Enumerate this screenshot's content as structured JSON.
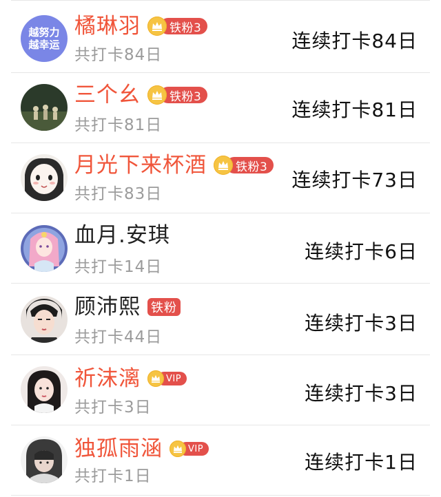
{
  "list": {
    "rows": [
      {
        "name": "橘琳羽",
        "name_color": "fan",
        "badge_type": "fan",
        "badge_label": "铁粉3",
        "total": "共打卡84日",
        "streak": "连续打卡84日"
      },
      {
        "name": "三个幺",
        "name_color": "fan",
        "badge_type": "fan",
        "badge_label": "铁粉3",
        "total": "共打卡81日",
        "streak": "连续打卡81日"
      },
      {
        "name": "月光下来杯酒",
        "name_color": "fan",
        "badge_type": "fan",
        "badge_label": "铁粉3",
        "total": "共打卡83日",
        "streak": "连续打卡73日"
      },
      {
        "name": "血月.安琪",
        "name_color": "plain",
        "badge_type": "none",
        "badge_label": "",
        "total": "共打卡14日",
        "streak": "连续打卡6日"
      },
      {
        "name": "顾沛熙",
        "name_color": "plain",
        "badge_type": "tag",
        "badge_label": "铁粉",
        "total": "共打卡44日",
        "streak": "连续打卡3日"
      },
      {
        "name": "祈沫漓",
        "name_color": "fan",
        "badge_type": "vip",
        "badge_label": "VIP",
        "total": "共打卡3日",
        "streak": "连续打卡3日"
      },
      {
        "name": "独孤雨涵",
        "name_color": "fan",
        "badge_type": "vip",
        "badge_label": "VIP",
        "total": "共打卡1日",
        "streak": "连续打卡1日"
      }
    ],
    "avatar_1_text": [
      "越努力",
      "越幸运"
    ]
  },
  "colors": {
    "fan_name": "#f0553a",
    "plain_name": "#222222",
    "badge_red": "#e3504b",
    "crown_gold": "#f6c443",
    "subtext": "#9b9b9b"
  },
  "icons": {
    "badge_crown": "crown-icon"
  }
}
